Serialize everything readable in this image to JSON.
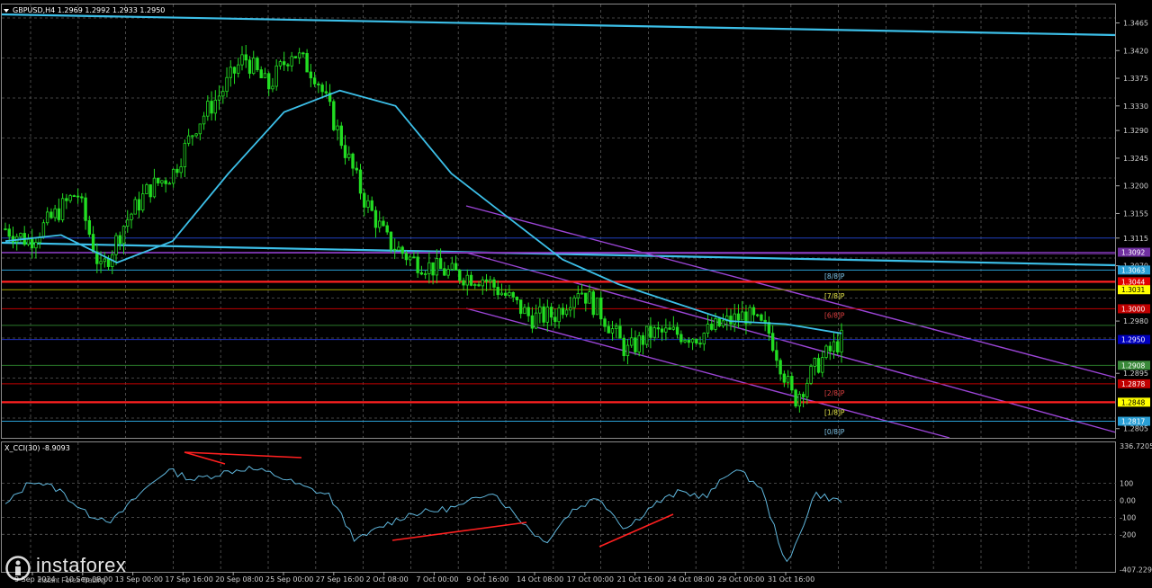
{
  "header": {
    "symbol_line": "GBPUSD,H4  1.2969 1.2992 1.2933 1.2950"
  },
  "indicator": {
    "label": "X_CCI(30) -8.9093"
  },
  "price_axis": {
    "ticks": [
      "1.3465",
      "1.3420",
      "1.3375",
      "1.3330",
      "1.3290",
      "1.3245",
      "1.3200",
      "1.3155",
      "1.3115",
      "1.3070",
      "1.2980",
      "1.2895",
      "1.2805"
    ],
    "tags": [
      {
        "text": "1.3092",
        "bg": "#7030a0",
        "fg": "#ffffff",
        "price": 1.3092
      },
      {
        "text": "1.3063",
        "bg": "#2a9fd6",
        "fg": "#ffffff",
        "price": 1.3063
      },
      {
        "text": "1.3044",
        "bg": "#e00000",
        "fg": "#ffffff",
        "price": 1.3044
      },
      {
        "text": "1.3031",
        "bg": "#ffff00",
        "fg": "#000000",
        "price": 1.3031
      },
      {
        "text": "1.3000",
        "bg": "#c00000",
        "fg": "#ffffff",
        "price": 1.3
      },
      {
        "text": "1.2950",
        "bg": "#0000c0",
        "fg": "#ffffff",
        "price": 1.295
      },
      {
        "text": "1.2908",
        "bg": "#3a8a3a",
        "fg": "#ffffff",
        "price": 1.2908
      },
      {
        "text": "1.2878",
        "bg": "#c00000",
        "fg": "#ffffff",
        "price": 1.2878
      },
      {
        "text": "1.2848",
        "bg": "#ffff00",
        "fg": "#000000",
        "price": 1.2848
      },
      {
        "text": "1.2817",
        "bg": "#2a9fd6",
        "fg": "#ffffff",
        "price": 1.2817
      }
    ]
  },
  "murrey_labels": [
    {
      "text": "[8/8]P",
      "color": "#7fc4e8",
      "price": 1.3053
    },
    {
      "text": "[7/8]P",
      "color": "#e8e84a",
      "price": 1.3021
    },
    {
      "text": "[6/8]P",
      "color": "#e04040",
      "price": 1.299
    },
    {
      "text": "[2/8]P",
      "color": "#e04040",
      "price": 1.2863
    },
    {
      "text": "[1/8]P",
      "color": "#e8e84a",
      "price": 1.2832
    },
    {
      "text": "[0/8]P",
      "color": "#7fc4e8",
      "price": 1.28
    }
  ],
  "cci_axis": {
    "ticks": [
      "336.7205",
      "100",
      "0.00",
      "-100",
      "-200",
      "-407.2291"
    ]
  },
  "time_axis": {
    "labels": [
      "9 Sep 2024",
      "10 Sep 08:00",
      "13 Sep 00:00",
      "17 Sep 16:00",
      "20 Sep 08:00",
      "25 Sep 00:00",
      "27 Sep 16:00",
      "2 Oct 08:00",
      "7 Oct 00:00",
      "9 Oct 16:00",
      "14 Oct 08:00",
      "17 Oct 00:00",
      "21 Oct 16:00",
      "24 Oct 08:00",
      "29 Oct 00:00",
      "31 Oct 16:00"
    ]
  },
  "branding": {
    "name": "instaforex",
    "tagline": "Instant Forex Trading"
  },
  "colors": {
    "background": "#000000",
    "grid": "#5a5a5a",
    "bull_candle": "#22dd22",
    "ma_line": "#3cbfe8",
    "channel": "#9b45d6",
    "cci_line": "#5fb6dc",
    "divergence": "#ff2020"
  },
  "chart_data": {
    "type": "candlestick",
    "symbol": "GBPUSD",
    "timeframe": "H4",
    "ohlc_last": {
      "open": 1.2969,
      "high": 1.2992,
      "low": 1.2933,
      "close": 1.295
    },
    "ylim": [
      1.279,
      1.3495
    ],
    "close_path": [
      {
        "t": "9 Sep",
        "p": 1.313
      },
      {
        "t": "10 Sep",
        "p": 1.311
      },
      {
        "t": "11 Sep",
        "p": 1.315
      },
      {
        "t": "12 Sep",
        "p": 1.319
      },
      {
        "t": "13 Sep",
        "p": 1.306
      },
      {
        "t": "16 Sep",
        "p": 1.314
      },
      {
        "t": "17 Sep",
        "p": 1.3195
      },
      {
        "t": "18 Sep",
        "p": 1.322
      },
      {
        "t": "20 Sep",
        "p": 1.33
      },
      {
        "t": "23 Sep",
        "p": 1.335
      },
      {
        "t": "25 Sep",
        "p": 1.341
      },
      {
        "t": "26 Sep",
        "p": 1.336
      },
      {
        "t": "27 Sep",
        "p": 1.342
      },
      {
        "t": "30 Sep",
        "p": 1.338
      },
      {
        "t": "2 Oct",
        "p": 1.328
      },
      {
        "t": "3 Oct",
        "p": 1.318
      },
      {
        "t": "4 Oct",
        "p": 1.311
      },
      {
        "t": "7 Oct",
        "p": 1.308
      },
      {
        "t": "9 Oct",
        "p": 1.3065
      },
      {
        "t": "11 Oct",
        "p": 1.3055
      },
      {
        "t": "14 Oct",
        "p": 1.305
      },
      {
        "t": "15 Oct",
        "p": 1.302
      },
      {
        "t": "16 Oct",
        "p": 1.2985
      },
      {
        "t": "17 Oct",
        "p": 1.299
      },
      {
        "t": "18 Oct",
        "p": 1.3035
      },
      {
        "t": "21 Oct",
        "p": 1.299
      },
      {
        "t": "22 Oct",
        "p": 1.293
      },
      {
        "t": "23 Oct",
        "p": 1.296
      },
      {
        "t": "24 Oct",
        "p": 1.296
      },
      {
        "t": "25 Oct",
        "p": 1.2955
      },
      {
        "t": "28 Oct",
        "p": 1.2975
      },
      {
        "t": "29 Oct",
        "p": 1.299
      },
      {
        "t": "30 Oct",
        "p": 1.296
      },
      {
        "t": "31 Oct",
        "p": 1.285
      },
      {
        "t": "1 Nov",
        "p": 1.291
      },
      {
        "t": "4 Nov",
        "p": 1.295
      }
    ],
    "ma_path": [
      {
        "t": "9 Sep",
        "p": 1.311
      },
      {
        "t": "12 Sep",
        "p": 1.312
      },
      {
        "t": "13 Sep",
        "p": 1.3075
      },
      {
        "t": "17 Sep",
        "p": 1.311
      },
      {
        "t": "20 Sep",
        "p": 1.322
      },
      {
        "t": "25 Sep",
        "p": 1.332
      },
      {
        "t": "27 Sep",
        "p": 1.3355
      },
      {
        "t": "2 Oct",
        "p": 1.333
      },
      {
        "t": "7 Oct",
        "p": 1.322
      },
      {
        "t": "9 Oct",
        "p": 1.315
      },
      {
        "t": "14 Oct",
        "p": 1.308
      },
      {
        "t": "17 Oct",
        "p": 1.304
      },
      {
        "t": "21 Oct",
        "p": 1.301
      },
      {
        "t": "24 Oct",
        "p": 1.298
      },
      {
        "t": "29 Oct",
        "p": 1.2975
      },
      {
        "t": "31 Oct",
        "p": 1.296
      }
    ],
    "cci_path": [
      {
        "t": "9 Sep",
        "v": -30
      },
      {
        "t": "10 Sep",
        "v": 120
      },
      {
        "t": "11 Sep",
        "v": 60
      },
      {
        "t": "12 Sep",
        "v": -80
      },
      {
        "t": "13 Sep",
        "v": -120
      },
      {
        "t": "16 Sep",
        "v": 40
      },
      {
        "t": "17 Sep",
        "v": 180
      },
      {
        "t": "18 Sep",
        "v": 120
      },
      {
        "t": "20 Sep",
        "v": 160
      },
      {
        "t": "23 Sep",
        "v": 190
      },
      {
        "t": "25 Sep",
        "v": 150
      },
      {
        "t": "27 Sep",
        "v": 80
      },
      {
        "t": "30 Sep",
        "v": 30
      },
      {
        "t": "2 Oct",
        "v": -240
      },
      {
        "t": "4 Oct",
        "v": -150
      },
      {
        "t": "7 Oct",
        "v": -80
      },
      {
        "t": "9 Oct",
        "v": -60
      },
      {
        "t": "11 Oct",
        "v": -30
      },
      {
        "t": "14 Oct",
        "v": 60
      },
      {
        "t": "15 Oct",
        "v": -100
      },
      {
        "t": "17 Oct",
        "v": -250
      },
      {
        "t": "18 Oct",
        "v": -60
      },
      {
        "t": "21 Oct",
        "v": 20
      },
      {
        "t": "22 Oct",
        "v": -170
      },
      {
        "t": "24 Oct",
        "v": -30
      },
      {
        "t": "25 Oct",
        "v": 50
      },
      {
        "t": "28 Oct",
        "v": 20
      },
      {
        "t": "29 Oct",
        "v": 190
      },
      {
        "t": "30 Oct",
        "v": 80
      },
      {
        "t": "31 Oct",
        "v": -390
      },
      {
        "t": "1 Nov",
        "v": 40
      },
      {
        "t": "4 Nov",
        "v": -9
      }
    ]
  }
}
